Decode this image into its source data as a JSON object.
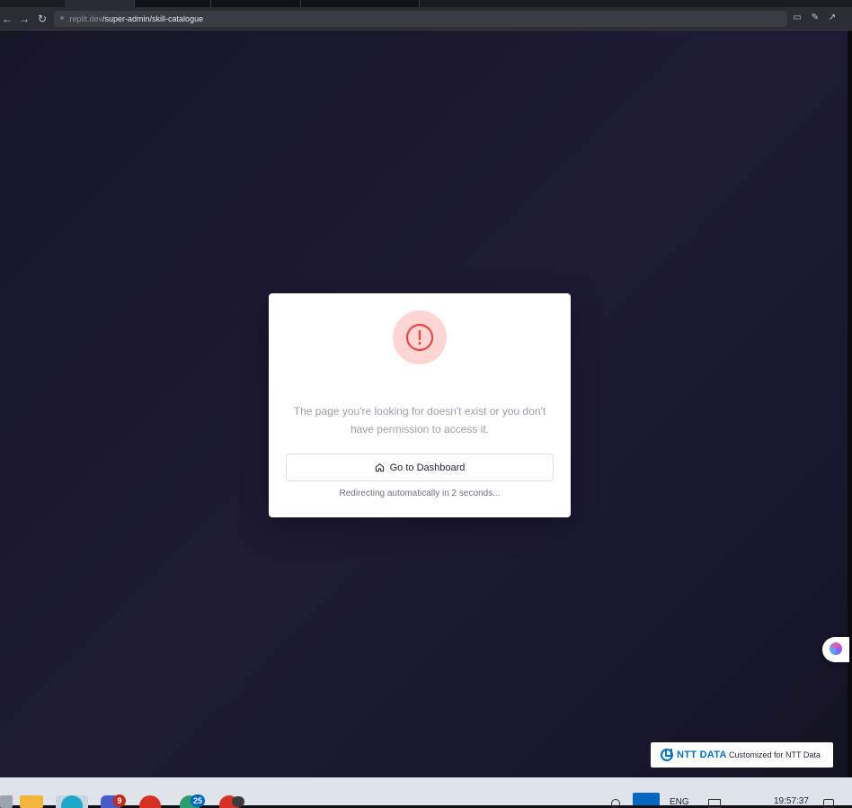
{
  "browser": {
    "url_host": ".replit.dev",
    "url_path": "/super-admin/skill-catalogue"
  },
  "error_card": {
    "message": "The page you're looking for doesn't exist or you don't have permission to access it.",
    "button_label": "Go to Dashboard",
    "redirect_text": "Redirecting automatically in 2 seconds...",
    "icon": "alert-circle-icon",
    "accent_color": "#ef4444",
    "icon_bg_color": "#fdd5d3"
  },
  "badge": {
    "brand": "NTT DATA",
    "caption": "Customized for NTT Data",
    "brand_color": "#0070c0"
  },
  "taskbar": {
    "badges": [
      "9",
      "25"
    ],
    "language": "ENG",
    "time": "19:57:37"
  }
}
